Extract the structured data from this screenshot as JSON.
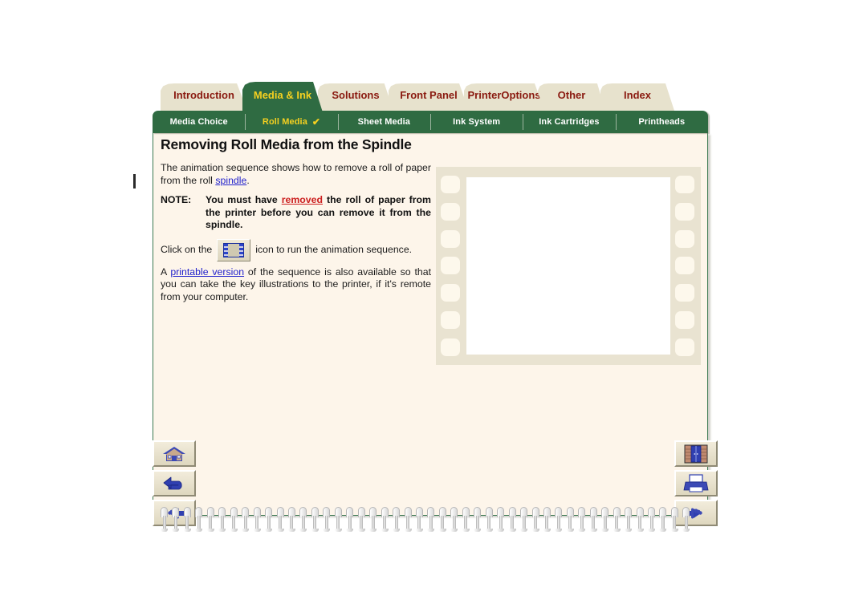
{
  "window": {
    "background_color": "#ffffff",
    "green": "#2f6b42",
    "tab_beige": "#e7e2cd",
    "tab_text": "#8a1a10",
    "active_tab_text": "#f5d020",
    "page_background": "#fdf5ea",
    "link_color": "#2222cc",
    "link_red": "#cc2020"
  },
  "tabs": [
    {
      "label": "Introduction",
      "active": false
    },
    {
      "label": "Media & Ink",
      "active": true
    },
    {
      "label": "Solutions",
      "active": false
    },
    {
      "label": "Front Panel",
      "active": false
    },
    {
      "label": "Printer Options",
      "active": false
    },
    {
      "label": "Other",
      "active": false
    },
    {
      "label": "Index",
      "active": false
    }
  ],
  "subnav": {
    "items": [
      {
        "label": "Media Choice",
        "active": false,
        "check": ""
      },
      {
        "label": "Roll Media",
        "active": true,
        "check": "✔"
      },
      {
        "label": "Sheet Media",
        "active": false,
        "check": ""
      },
      {
        "label": "Ink System",
        "active": false,
        "check": ""
      },
      {
        "label": "Ink Cartridges",
        "active": false,
        "check": ""
      },
      {
        "label": "Printheads",
        "active": false,
        "check": ""
      }
    ]
  },
  "content": {
    "heading": "Removing Roll Media from the Spindle",
    "para1_pre": "The animation sequence shows how to remove a roll of paper from the roll ",
    "para1_link": "spindle",
    "para1_post": ".",
    "note_label": "NOTE:",
    "note_pre": "You must have ",
    "note_link": "removed",
    "note_post": " the roll of paper from the printer before you can remove it from the spindle.",
    "click_pre": "Click on the",
    "click_post": "icon to run the animation sequence.",
    "para3_pre": "A ",
    "para3_link": "printable version",
    "para3_post": " of the sequence is also available so that you can take the key illustrations to the printer, if it's remote from your computer."
  },
  "filmstrip": {
    "alt": "animation film frame placeholder",
    "sprocket_count": 7
  },
  "nav_buttons": {
    "home": {
      "icon": "home-icon",
      "title": "Home"
    },
    "back": {
      "icon": "back-arrow-icon",
      "title": "Back"
    },
    "prev": {
      "icon": "previous-hand-icon",
      "title": "Previous page"
    },
    "library": {
      "icon": "bookshelf-icon",
      "title": "Bookshelf"
    },
    "print": {
      "icon": "printer-icon",
      "title": "Print"
    },
    "next": {
      "icon": "next-hand-icon",
      "title": "Next page"
    }
  },
  "spiral": {
    "coil_count": 46
  }
}
